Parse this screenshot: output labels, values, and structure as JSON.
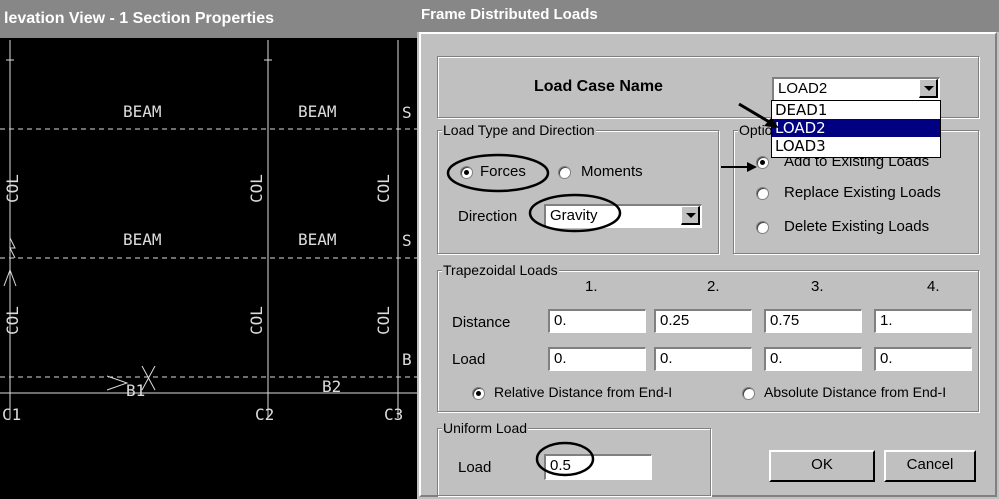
{
  "cad_view": {
    "title": "levation View - 1  Section Properties",
    "beam_labels": [
      "BEAM",
      "BEAM",
      "BEAM",
      "BEAM"
    ],
    "col_labels": [
      "COL",
      "COL",
      "COL",
      "COL",
      "COL",
      "COL"
    ],
    "edge_fragments": [
      "S",
      "S",
      "B"
    ],
    "bottom_labels": [
      "B1",
      "B2"
    ],
    "column_ids": [
      "C1",
      "C2",
      "C3"
    ]
  },
  "dialog": {
    "title": "Frame Distributed Loads",
    "load_case": {
      "label": "Load Case Name",
      "value": "LOAD2",
      "options": [
        "DEAD1",
        "LOAD2",
        "LOAD3"
      ],
      "highlighted": "LOAD2"
    },
    "load_type": {
      "title": "Load Type and Direction",
      "forces_label": "Forces",
      "moments_label": "Moments",
      "selected": "Forces",
      "direction_label": "Direction",
      "direction_value": "Gravity"
    },
    "options": {
      "title": "Options",
      "add_label": "Add to Existing Loads",
      "replace_label": "Replace Existing Loads",
      "delete_label": "Delete Existing Loads",
      "selected": "Add to Existing Loads"
    },
    "trapezoidal": {
      "title": "Trapezoidal Loads",
      "columns": [
        "1.",
        "2.",
        "3.",
        "4."
      ],
      "distance_label": "Distance",
      "distance_values": [
        "0.",
        "0.25",
        "0.75",
        "1."
      ],
      "load_label": "Load",
      "load_values": [
        "0.",
        "0.",
        "0.",
        "0."
      ],
      "relative_label": "Relative Distance from End-I",
      "absolute_label": "Absolute Distance from End-I",
      "selected": "Relative Distance from End-I"
    },
    "uniform": {
      "title": "Uniform Load",
      "load_label": "Load",
      "load_value": "0.5"
    },
    "ok_label": "OK",
    "cancel_label": "Cancel"
  }
}
